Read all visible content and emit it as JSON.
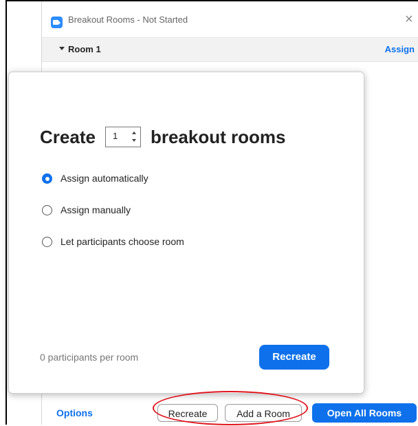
{
  "window": {
    "title": "Breakout Rooms - Not Started",
    "close_glyph": "×"
  },
  "room_list": {
    "room_name": "Room 1",
    "assign_label": "Assign"
  },
  "popup": {
    "create_prefix": "Create",
    "room_count": "1",
    "create_suffix": "breakout rooms",
    "options": [
      {
        "label": "Assign automatically",
        "selected": true
      },
      {
        "label": "Assign manually",
        "selected": false
      },
      {
        "label": "Let participants choose room",
        "selected": false
      }
    ],
    "per_room_text": "0 participants per room",
    "recreate_label": "Recreate"
  },
  "footer": {
    "options_label": "Options",
    "recreate_label": "Recreate",
    "add_room_label": "Add a Room",
    "open_all_label": "Open All Rooms"
  },
  "colors": {
    "accent": "#0e71eb",
    "highlight": "#e0141e"
  }
}
